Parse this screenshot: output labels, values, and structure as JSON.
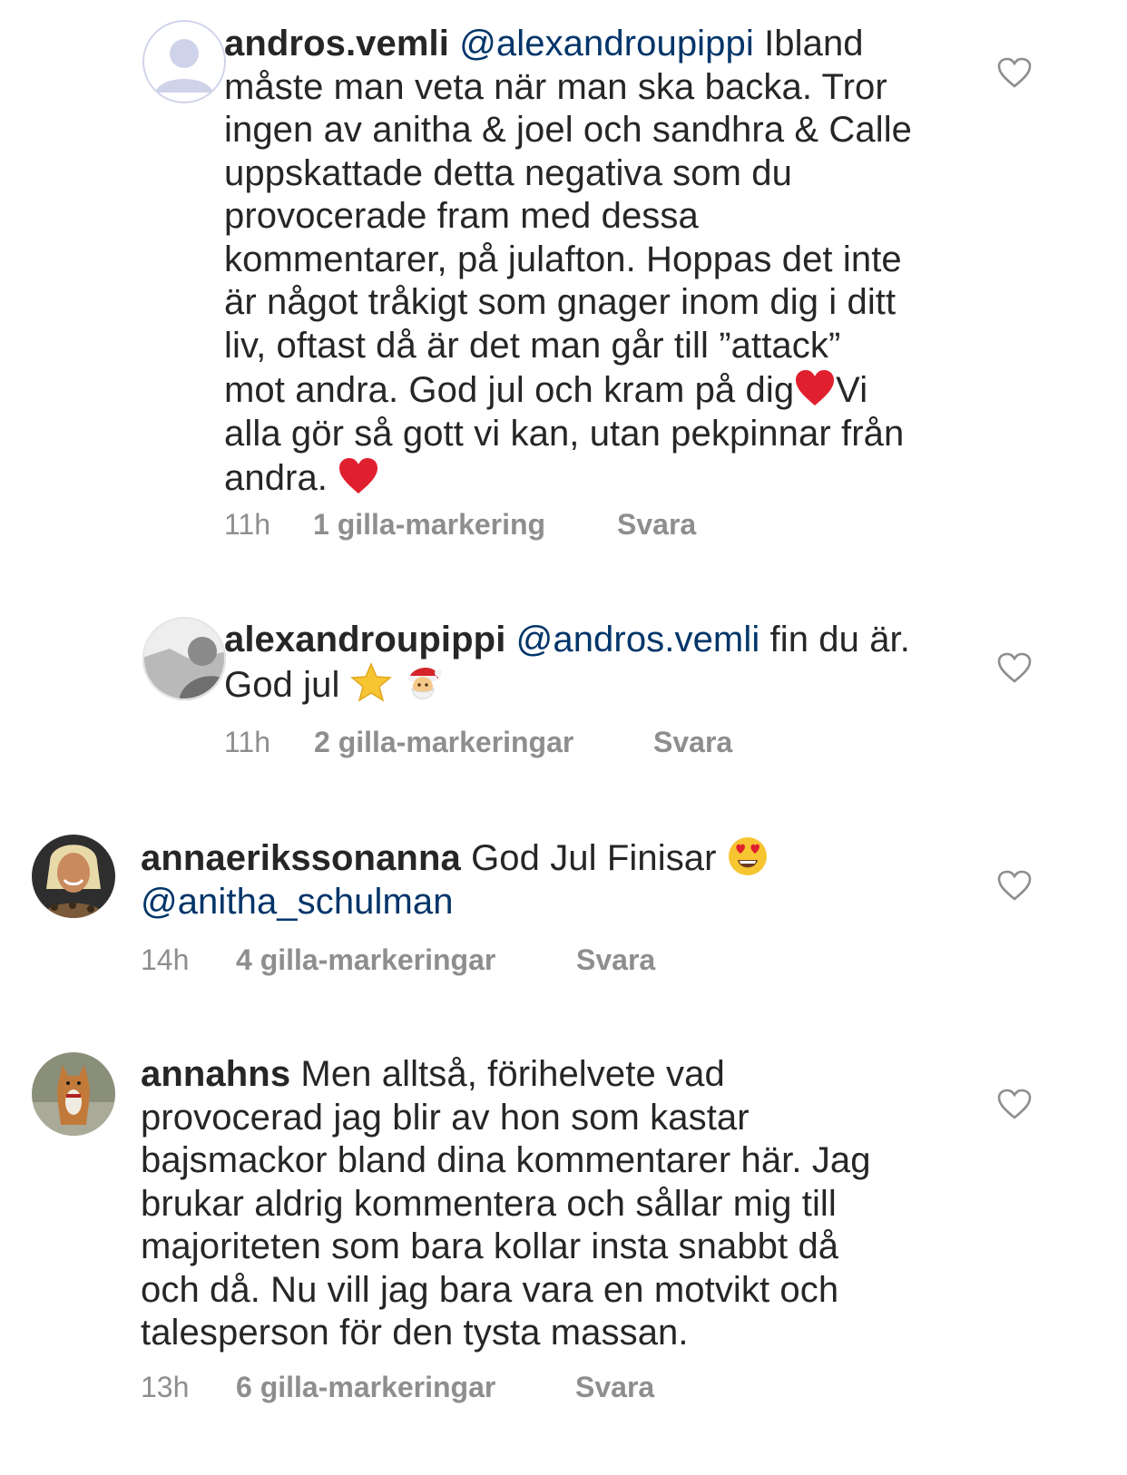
{
  "comments": [
    {
      "username": "andros.vemli",
      "mention": "@alexandroupippi",
      "text_part1": "Ibland",
      "line2": "måste man veta när man ska backa. Tror",
      "line3": "ingen av anitha & joel och sandhra & Calle",
      "line4": "uppskattade detta negativa som du",
      "line5": "provocerade fram med dessa",
      "line6": "kommentarer, på julafton. Hoppas det inte",
      "line7": "är något tråkigt som gnager inom dig i ditt",
      "line8": "liv, oftast då är det man går till ”attack”",
      "line9a": "mot andra. God jul och kram på dig",
      "line9b": "Vi",
      "line10": "alla gör så gott vi kan, utan pekpinnar från",
      "line11": "andra. ",
      "time": "11h",
      "likes": "1 gilla-markering",
      "reply": "Svara",
      "avatar": "default-avatar"
    },
    {
      "username": "alexandroupippi",
      "mention": "@andros.vemli",
      "text_part1": "fin du är.",
      "line2": "God jul ",
      "time": "11h",
      "likes": "2 gilla-markeringar",
      "reply": "Svara",
      "avatar": "photo-avatar"
    },
    {
      "username": "annaerikssonanna",
      "text_part1": "God Jul Finisar ",
      "mention": "@anitha_schulman",
      "time": "14h",
      "likes": "4 gilla-markeringar",
      "reply": "Svara",
      "avatar": "photo-avatar"
    },
    {
      "username": "annahns",
      "text_part1": "Men alltså, förihelvete vad",
      "line2": "provocerad jag blir av hon som kastar",
      "line3": "bajsmackor bland dina kommentarer här. Jag",
      "line4": "brukar aldrig kommentera och sållar mig till",
      "line5": "majoriteten som bara kollar insta snabbt då",
      "line6": "och då. Nu vill jag bara vara en motvikt och",
      "line7": "talesperson för den tysta massan.",
      "time": "13h",
      "likes": "6 gilla-markeringar",
      "reply": "Svara",
      "avatar": "photo-avatar"
    }
  ],
  "colors": {
    "text": "#262626",
    "mention": "#003569",
    "meta": "#8e8e8e",
    "heart_outline": "#8e8e8e"
  }
}
